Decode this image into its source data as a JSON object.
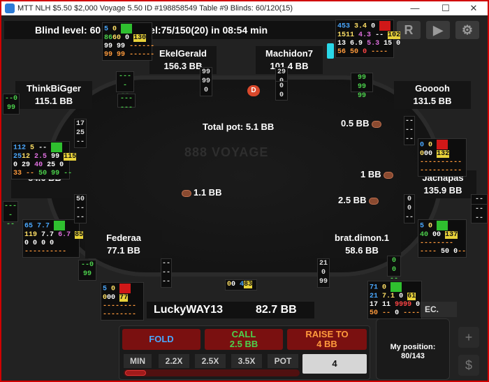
{
  "window": {
    "title": "MTT NLH $5.50 $2,000 Voyage 5.50 ID #198858549 Table #9 Blinds: 60/120(15)",
    "minimize": "—",
    "maximize": "☐",
    "close": "✕"
  },
  "header": {
    "level_text": "Blind level: 60 , Next Level:75/150(20) in 08:54 min",
    "buttons": {
      "replay": "R",
      "play": "▶",
      "settings": "⚙"
    }
  },
  "table": {
    "watermark": "888 VOYAGE",
    "pot": "Total pot: 5.1 BB",
    "dealer": "D"
  },
  "players": {
    "ekel": {
      "name": "EkelGerald",
      "stack": "156.3 BB"
    },
    "machidon": {
      "name": "Machidon7",
      "stack": "101.4 BB"
    },
    "think": {
      "name": "ThinkBiGger",
      "stack": "115.1 BB"
    },
    "gooooh": {
      "name": "Gooooh",
      "stack": "131.5 BB"
    },
    "left": {
      "name": "",
      "stack": "84.6 BB"
    },
    "jachapas": {
      "name": "Jachapas",
      "stack": "135.9 BB"
    },
    "federaa": {
      "name": "Federaa",
      "stack": "77.1 BB"
    },
    "brat": {
      "name": "brat.dimon.1",
      "stack": "58.6 BB"
    },
    "hero": {
      "name": "LuckyWAY13",
      "stack": "82.7 BB"
    }
  },
  "bets": {
    "gooooh": "0.5 BB",
    "jachapas_1": "1 BB",
    "jachapas_2": "2.5 BB",
    "left": "1.1 BB"
  },
  "hud": {
    "ekel": {
      "r1": [
        "5",
        "0",
        "",
        ""
      ],
      "r2": [
        "86",
        "60",
        "0",
        "130"
      ],
      "r3": [
        "99",
        "99",
        "--",
        "--",
        "--"
      ],
      "r4": [
        "99",
        "99",
        "--",
        "--",
        "--"
      ]
    },
    "machidon": {
      "r1": [
        "453",
        "3.4",
        "0",
        ""
      ],
      "r2": [
        "1511",
        "4.3",
        "--",
        "102"
      ],
      "r3": [
        "13",
        "6.9",
        "5.3",
        "15",
        "0"
      ],
      "r4": [
        "56",
        "50",
        "0",
        "--",
        "--"
      ]
    },
    "think": {
      "r1": [
        "112",
        "5",
        "--",
        ""
      ],
      "r2": [
        "25",
        "12",
        "2.5",
        "99",
        "115"
      ],
      "r3": [
        "0",
        "29",
        "40",
        "25",
        "0"
      ],
      "r4": [
        "33",
        "--",
        "50",
        "99",
        "--"
      ]
    },
    "jachapas": {
      "r1": [
        "0",
        "0",
        ""
      ],
      "r2": [
        "0",
        "0",
        "0",
        "132"
      ],
      "r3": [
        "--",
        "--",
        "--",
        "--",
        "--"
      ],
      "r4": [
        "--",
        "--",
        "--",
        "--",
        "--"
      ]
    },
    "federaa": {
      "r1": [
        "65",
        "7.7",
        ""
      ],
      "r2": [
        "119",
        "7.7",
        "6.7",
        "85"
      ],
      "r3": [
        "0",
        "0",
        "0",
        "0"
      ],
      "r4": [
        "--",
        "--",
        "--",
        "--",
        "--"
      ]
    },
    "brat": {
      "r1": [
        "5",
        "0",
        ""
      ],
      "r2": [
        "40",
        "0",
        "0",
        "137"
      ],
      "r3": [
        "--",
        "--",
        "--",
        "--"
      ],
      "r4": [
        "--",
        "--",
        "50",
        "0",
        "--"
      ]
    },
    "hero_left": {
      "r1": [
        "5",
        "0",
        ""
      ],
      "r2": [
        "0",
        "0",
        "0",
        "77"
      ],
      "r3": [
        "--",
        "--",
        "--",
        "--"
      ],
      "r4": [
        "--",
        "--",
        "--",
        "--"
      ]
    },
    "hero_right": {
      "r1": [
        "71",
        "0",
        ""
      ],
      "r2": [
        "21",
        "7.1",
        "0",
        "61"
      ],
      "r3": [
        "17",
        "11",
        "99",
        "99",
        "0"
      ],
      "r4": [
        "50",
        "--",
        "0",
        "--",
        "--"
      ]
    },
    "hero_center": [
      "0",
      "0",
      "4",
      "83"
    ]
  },
  "mini_huds": {
    "m1": [
      "99",
      "99",
      "0"
    ],
    "m2": [
      "29",
      "0",
      "0"
    ],
    "m3": [
      "99",
      "99",
      "99"
    ],
    "m4": [
      "--",
      "--",
      "--"
    ],
    "m5": [
      "--",
      "0",
      "99"
    ],
    "m6": [
      "17",
      "25",
      "--"
    ],
    "m7": [
      "--",
      "--",
      "--"
    ],
    "m8": [
      "50",
      "--",
      "--"
    ],
    "m9": [
      "--",
      "--",
      "--"
    ],
    "m10": [
      "--",
      "--",
      "--"
    ],
    "m11": [
      "0",
      "0",
      "--"
    ],
    "m12": [
      "0",
      "0",
      "--"
    ],
    "m13": [
      "21",
      "0",
      "99"
    ],
    "m14": [
      "0",
      "0",
      "--"
    ],
    "m15": [
      "--",
      "--",
      "--"
    ],
    "m16": [
      "--",
      "0",
      "99"
    ],
    "m17": [
      "--",
      "--",
      "--"
    ],
    "m18": [
      "--",
      "--",
      "--"
    ]
  },
  "hero_tag": "EC.",
  "actions": {
    "fold": "FOLD",
    "call_line1": "CALL",
    "call_line2": "2.5 BB",
    "raise_line1": "RAISE TO",
    "raise_line2": "4 BB",
    "presets": [
      "MIN",
      "2.2X",
      "2.5X",
      "3.5X",
      "POT"
    ],
    "bet_value": "4"
  },
  "position": {
    "label": "My position:",
    "value": "80/143"
  },
  "side_buttons": {
    "add": "+",
    "cashier": "$"
  },
  "colors": {
    "frame": "#d00000",
    "action": "#7a1010",
    "fold_text": "#4aa8ff",
    "call_text": "#4cd14c",
    "raise_text": "#ff9a3c"
  }
}
